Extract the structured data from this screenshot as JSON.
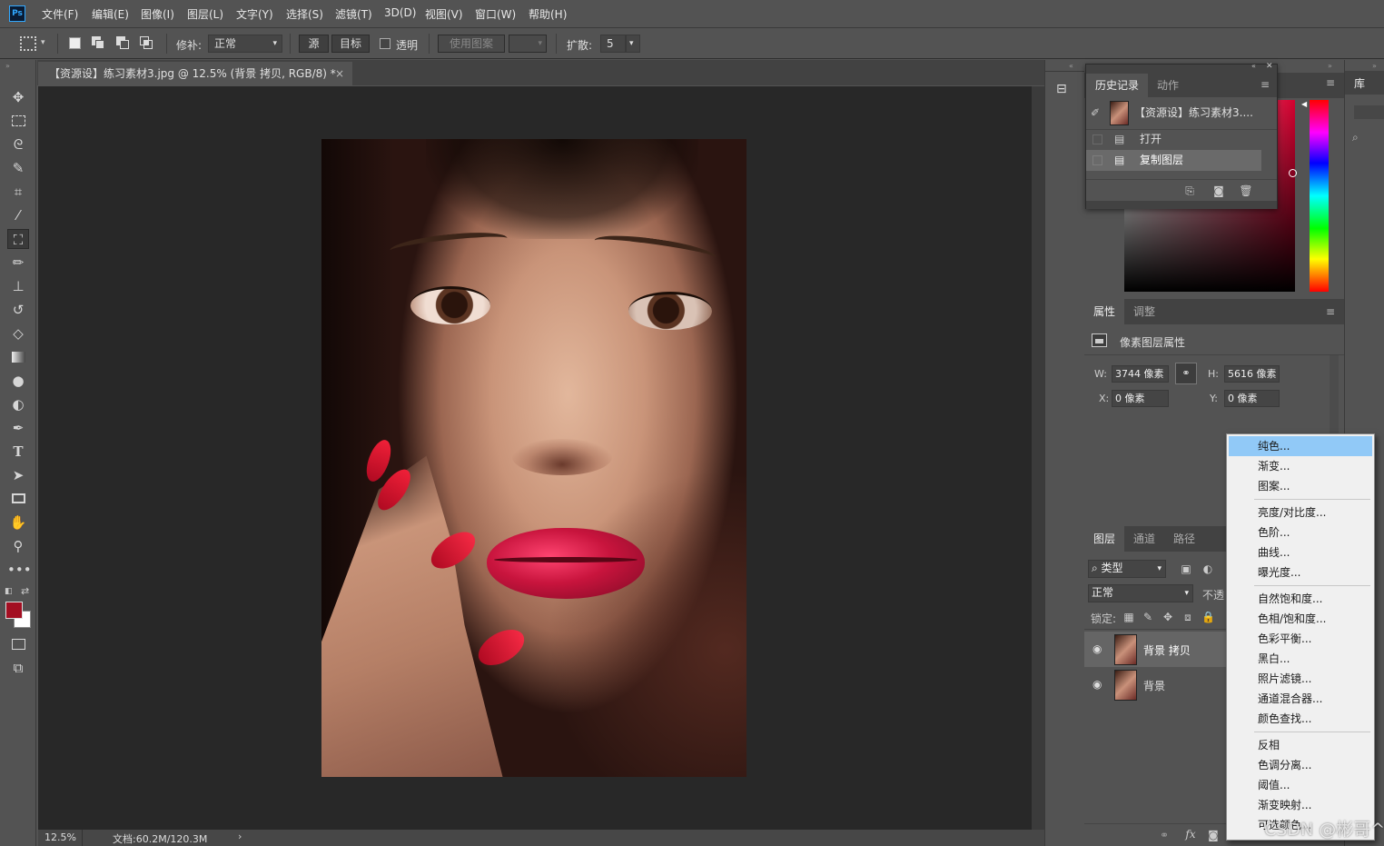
{
  "app": {
    "logo": "Ps"
  },
  "menu": [
    "文件(F)",
    "编辑(E)",
    "图像(I)",
    "图层(L)",
    "文字(Y)",
    "选择(S)",
    "滤镜(T)",
    "3D(D)",
    "视图(V)",
    "窗口(W)",
    "帮助(H)"
  ],
  "options": {
    "patch_label": "修补:",
    "patch_value": "正常",
    "source_btn": "源",
    "target_btn": "目标",
    "transparent_label": "透明",
    "use_pattern_btn": "使用图案",
    "diffusion_label": "扩散:",
    "diffusion_value": "5"
  },
  "document": {
    "tab_title": "【资源设】练习素材3.jpg @ 12.5% (背景 拷贝, RGB/8) *",
    "close": "×",
    "zoom": "12.5%",
    "doc_info": "文档:60.2M/120.3M",
    "status_arrow": "›"
  },
  "history_panel": {
    "tab_history": "历史记录",
    "tab_actions": "动作",
    "snapshot_label": "【资源设】练习素材3....",
    "items": [
      "打开",
      "复制图层"
    ]
  },
  "properties_panel": {
    "tab_properties": "属性",
    "tab_adjustments": "调整",
    "section_title": "像素图层属性",
    "w_label": "W:",
    "w_value": "3744 像素",
    "h_label": "H:",
    "h_value": "5616 像素",
    "x_label": "X:",
    "x_value": "0 像素",
    "y_label": "Y:",
    "y_value": "0 像素"
  },
  "layers_panel": {
    "tab_layers": "图层",
    "tab_channels": "通道",
    "tab_paths": "路径",
    "filter_kind": "类型",
    "blend_mode": "正常",
    "opacity_label": "不透",
    "lock_label": "锁定:",
    "layers": [
      {
        "name": "背景 拷贝",
        "selected": true
      },
      {
        "name": "背景",
        "selected": false
      }
    ]
  },
  "library": {
    "tab": "库"
  },
  "adjustment_menu": {
    "groups": [
      [
        "纯色...",
        "渐变...",
        "图案..."
      ],
      [
        "亮度/对比度...",
        "色阶...",
        "曲线...",
        "曝光度..."
      ],
      [
        "自然饱和度...",
        "色相/饱和度...",
        "色彩平衡...",
        "黑白...",
        "照片滤镜...",
        "通道混合器...",
        "颜色查找..."
      ],
      [
        "反相",
        "色调分离...",
        "阈值...",
        "渐变映射...",
        "可选颜色..."
      ]
    ],
    "highlighted": "纯色..."
  },
  "watermark": "CSDN @彬哥^",
  "colors": {
    "foreground": "#a30f22",
    "background": "#ffffff",
    "accent": "#31a8ff",
    "menu_highlight": "#91c9f7"
  }
}
